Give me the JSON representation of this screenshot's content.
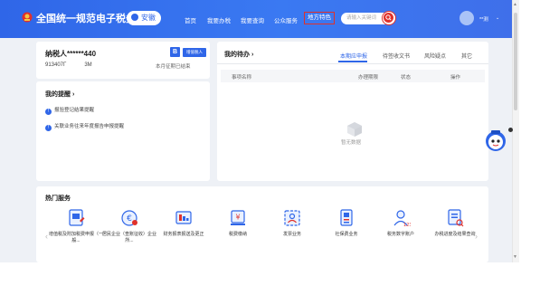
{
  "header": {
    "site_title": "全国统一规范电子税务局",
    "region": "安徽",
    "nav": [
      "首页",
      "我要办税",
      "我要查询",
      "公众服务",
      "地方特色"
    ],
    "active_nav": "地方特色",
    "search_placeholder": "请输入关键词",
    "user": "**测",
    "brand_color": "#2f66e8",
    "highlight_color": "#e0312b"
  },
  "taxpayer": {
    "name": "纳税人******440",
    "id": "913407Γ",
    "id_suffix": "3M",
    "badge": "B",
    "type": "增值税人",
    "status": "本月征期已结束"
  },
  "reminders": {
    "title": "我的提醒",
    "title_arrow": "›",
    "items": [
      "报验登记结果提醒",
      "关联业务往来年度报告申报提醒"
    ]
  },
  "todo": {
    "title": "我的待办",
    "title_arrow": "›",
    "tabs": [
      "本期应申报",
      "待签收文书",
      "风险疑点",
      "其它"
    ],
    "active_tab": "本期应申报",
    "columns": [
      "事项名称",
      "办理期限",
      "状态",
      "操作"
    ],
    "empty_text": "暂无数据"
  },
  "services": {
    "title": "热门服务",
    "prev": "‹",
    "next": "›",
    "items": [
      {
        "label": "增值税及附加税费申报（一般...",
        "icon": "vat-declare-icon"
      },
      {
        "label": "居民企业（查账征收）企业所...",
        "icon": "enterprise-tax-icon"
      },
      {
        "label": "财务报表报送及更正",
        "icon": "financial-report-icon"
      },
      {
        "label": "税费缴纳",
        "icon": "tax-payment-icon"
      },
      {
        "label": "发票业务",
        "icon": "invoice-icon"
      },
      {
        "label": "社保费业务",
        "icon": "social-insurance-icon"
      },
      {
        "label": "税务数字账户",
        "icon": "digital-account-icon"
      },
      {
        "label": "办税进度及结果查询",
        "icon": "progress-query-icon"
      }
    ]
  }
}
